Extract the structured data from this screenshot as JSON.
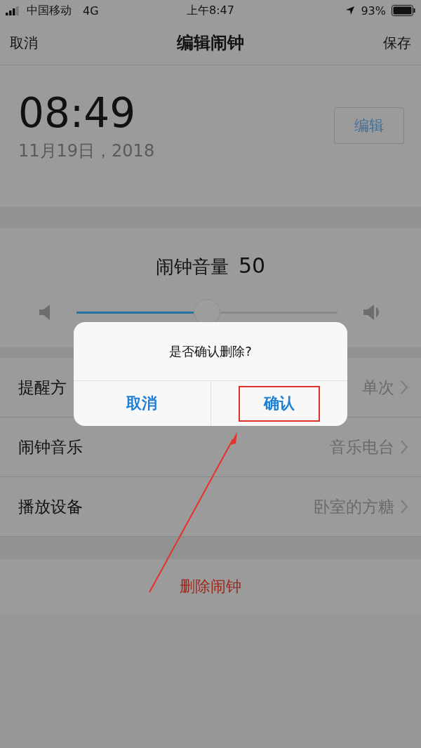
{
  "status_bar": {
    "carrier": "中国移动",
    "network": "4G",
    "time": "上午8:47",
    "battery": "93%"
  },
  "nav": {
    "left": "取消",
    "title": "编辑闹钟",
    "right": "保存"
  },
  "alarm": {
    "time": "08:49",
    "date": "11月19日，2018",
    "edit_button": "编辑"
  },
  "volume": {
    "label": "闹钟音量",
    "value": "50",
    "level": 0.5
  },
  "settings": [
    {
      "label": "提醒方",
      "value": "单次"
    },
    {
      "label": "闹钟音乐",
      "value": "音乐电台"
    },
    {
      "label": "播放设备",
      "value": "卧室的方糖"
    }
  ],
  "delete_button": "删除闹钟",
  "dialog": {
    "message": "是否确认删除?",
    "buttons": [
      {
        "label": "取消",
        "highlighted": false
      },
      {
        "label": "确认",
        "highlighted": true
      }
    ]
  }
}
